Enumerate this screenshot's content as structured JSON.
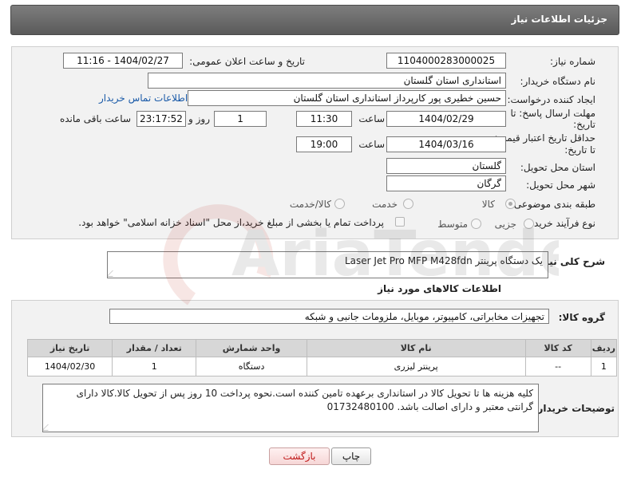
{
  "header": {
    "title": "جزئیات اطلاعات نیاز"
  },
  "form": {
    "need_number": {
      "label": "شماره نیاز:",
      "value": "1104000283000025"
    },
    "announce_datetime": {
      "label": "تاریخ و ساعت اعلان عمومی:",
      "value": "1404/02/27 - 11:16"
    },
    "buyer_org": {
      "label": "نام دستگاه خریدار:",
      "value": "استانداری استان گلستان"
    },
    "requester": {
      "label": "ایجاد کننده درخواست:",
      "value": "حسین خطیری پور کارپرداز استانداری استان گلستان",
      "contact_link": "اطلاعات تماس خریدار"
    },
    "response_deadline": {
      "label_line1": "مهلت ارسال پاسخ: تا",
      "label_line2": "تاریخ:",
      "date": "1404/02/29",
      "time_label": "ساعت",
      "time": "11:30",
      "days": "1",
      "days_label": "روز و",
      "remaining": "23:17:52",
      "remaining_label": "ساعت باقی مانده"
    },
    "price_validity": {
      "label_line1": "حداقل تاریخ اعتبار قیمت:",
      "label_line2": "تا تاریخ:",
      "date": "1404/03/16",
      "time_label": "ساعت",
      "time": "19:00"
    },
    "delivery_province": {
      "label": "استان محل تحویل:",
      "value": "گلستان"
    },
    "delivery_city": {
      "label": "شهر محل تحویل:",
      "value": "گرگان"
    },
    "category": {
      "label": "طبقه بندی موضوعی:",
      "options": [
        "کالا",
        "خدمت",
        "کالا/خدمت"
      ],
      "selected": "کالا"
    },
    "purchase_type": {
      "label": "نوع فرآیند خرید :",
      "options": [
        "جزیی",
        "متوسط"
      ],
      "note": "پرداخت تمام یا بخشی از مبلغ خرید،از محل \"اسناد خزانه اسلامی\" خواهد بود."
    }
  },
  "summary": {
    "label": "شرح کلی نیاز:",
    "value": "یک دستگاه پرینتر Laser Jet Pro MFP M428fdn"
  },
  "goods": {
    "section_title": "اطلاعات کالاهای مورد نیاز",
    "group_label": "گروه کالا:",
    "group_value": "تجهیزات مخابراتی، کامپیوتر، موبایل، ملزومات جانبی و شبکه",
    "columns": [
      "ردیف",
      "کد کالا",
      "نام کالا",
      "واحد شمارش",
      "تعداد / مقدار",
      "تاریخ نیاز"
    ],
    "rows": [
      {
        "row": "1",
        "code": "--",
        "name": "پرینتر لیزری",
        "unit": "دستگاه",
        "qty": "1",
        "date": "1404/02/30"
      }
    ]
  },
  "buyer_notes": {
    "label": "توضیحات خریدار:",
    "text": "کلیه هزینه ها تا تحویل کالا در استانداری برعهده تامین کننده است.نحوه پرداخت 10 روز پس از تحویل کالا.کالا دارای گرانتی معتبر و دارای اصالت باشد. 01732480100"
  },
  "buttons": {
    "print": "چاپ",
    "back": "بازگشت"
  },
  "watermark": {
    "text": "AriaTender.neT"
  }
}
